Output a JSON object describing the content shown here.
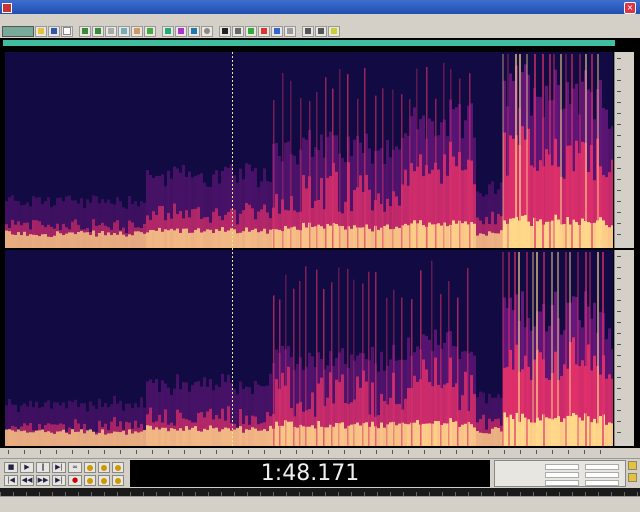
{
  "window": {
    "title": "",
    "close_glyph": "×"
  },
  "menu": [],
  "time_display": "1:48.171",
  "icons": {
    "app": "app-icon",
    "close": "close-icon"
  },
  "colors": {
    "spectral_background": "#120a43",
    "spectral_low": "#7a1a8a",
    "spectral_mid": "#e0306a",
    "spectral_high": "#ffd88a",
    "overview_bar": "#3fbf9f",
    "time_display_bg": "#000000",
    "time_display_text": "#eeeeee"
  }
}
